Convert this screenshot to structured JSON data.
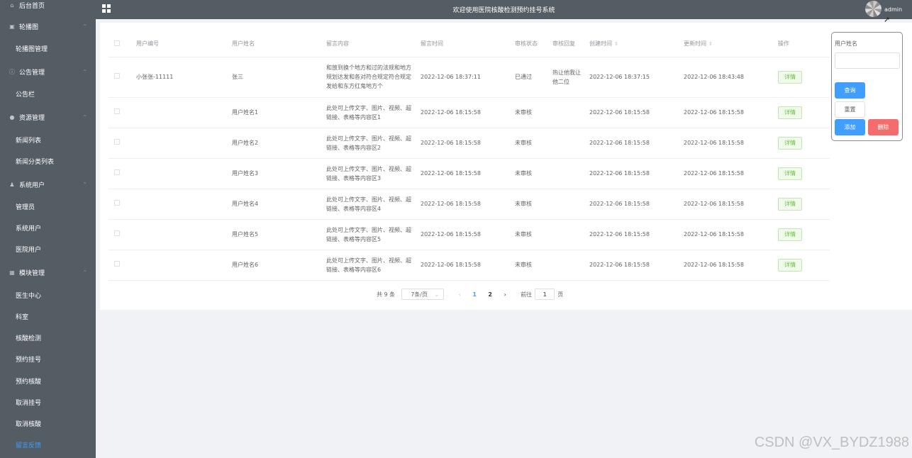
{
  "header": {
    "title": "欢迎使用医院核酸检测预约挂号系统",
    "user": "admin"
  },
  "sidebar": {
    "items": [
      {
        "label": "后台首页",
        "type": "group",
        "icon": "home-icon"
      },
      {
        "label": "轮播图",
        "type": "group",
        "icon": "image-icon"
      },
      {
        "label": "轮播图管理",
        "type": "sub"
      },
      {
        "label": "公告管理",
        "type": "group",
        "icon": "info-icon"
      },
      {
        "label": "公告栏",
        "type": "sub"
      },
      {
        "label": "资源管理",
        "type": "group",
        "icon": "location-icon"
      },
      {
        "label": "新闻列表",
        "type": "sub"
      },
      {
        "label": "新闻分类列表",
        "type": "sub"
      },
      {
        "label": "系统用户",
        "type": "group",
        "icon": "user-icon"
      },
      {
        "label": "管理员",
        "type": "sub"
      },
      {
        "label": "系统用户",
        "type": "sub"
      },
      {
        "label": "医院用户",
        "type": "sub"
      },
      {
        "label": "模块管理",
        "type": "group",
        "icon": "menu-icon"
      },
      {
        "label": "医生中心",
        "type": "sub"
      },
      {
        "label": "科室",
        "type": "sub"
      },
      {
        "label": "核酸检测",
        "type": "sub"
      },
      {
        "label": "预约挂号",
        "type": "sub"
      },
      {
        "label": "预约核酸",
        "type": "sub"
      },
      {
        "label": "取消挂号",
        "type": "sub"
      },
      {
        "label": "取消核酸",
        "type": "sub"
      },
      {
        "label": "留言反馈",
        "type": "sub",
        "active": true
      }
    ]
  },
  "table": {
    "columns": [
      "用户编号",
      "用户姓名",
      "留言内容",
      "留言时间",
      "审核状态",
      "审核回复",
      "创建时间",
      "更新时间",
      "操作"
    ],
    "detail_label": "详情",
    "rows": [
      {
        "user_no": "小张张-11111",
        "user_name": "张三",
        "content": "和放到换个地方和过的法规和地方规划达发和各对符合规定符合规定发给和东方红鬼地方个",
        "msg_time": "2022-12-06 18:37:11",
        "status": "已通过",
        "reply": "热让他我让他二位",
        "created": "2022-12-06 18:37:15",
        "updated": "2022-12-06 18:43:48"
      },
      {
        "user_no": "",
        "user_name": "用户姓名1",
        "content": "此处可上传文字、图片、视频、超链接、表格等内容区1",
        "msg_time": "2022-12-06 18:15:58",
        "status": "未审核",
        "reply": "",
        "created": "2022-12-06 18:15:58",
        "updated": "2022-12-06 18:15:58"
      },
      {
        "user_no": "",
        "user_name": "用户姓名2",
        "content": "此处可上传文字、图片、视频、超链接、表格等内容区2",
        "msg_time": "2022-12-06 18:15:58",
        "status": "未审核",
        "reply": "",
        "created": "2022-12-06 18:15:58",
        "updated": "2022-12-06 18:15:58"
      },
      {
        "user_no": "",
        "user_name": "用户姓名3",
        "content": "此处可上传文字、图片、视频、超链接、表格等内容区3",
        "msg_time": "2022-12-06 18:15:58",
        "status": "未审核",
        "reply": "",
        "created": "2022-12-06 18:15:58",
        "updated": "2022-12-06 18:15:58"
      },
      {
        "user_no": "",
        "user_name": "用户姓名4",
        "content": "此处可上传文字、图片、视频、超链接、表格等内容区4",
        "msg_time": "2022-12-06 18:15:58",
        "status": "未审核",
        "reply": "",
        "created": "2022-12-06 18:15:58",
        "updated": "2022-12-06 18:15:58"
      },
      {
        "user_no": "",
        "user_name": "用户姓名5",
        "content": "此处可上传文字、图片、视频、超链接、表格等内容区5",
        "msg_time": "2022-12-06 18:15:58",
        "status": "未审核",
        "reply": "",
        "created": "2022-12-06 18:15:58",
        "updated": "2022-12-06 18:15:58"
      },
      {
        "user_no": "",
        "user_name": "用户姓名6",
        "content": "此处可上传文字、图片、视频、超链接、表格等内容区6",
        "msg_time": "2022-12-06 18:15:58",
        "status": "未审核",
        "reply": "",
        "created": "2022-12-06 18:15:58",
        "updated": "2022-12-06 18:15:58"
      }
    ]
  },
  "pagination": {
    "total": "共 9 条",
    "page_size": "7条/页",
    "pages": [
      "1",
      "2"
    ],
    "current": "1",
    "goto_prefix": "前往",
    "goto_value": "1",
    "goto_suffix": "页"
  },
  "search": {
    "label": "用户姓名",
    "input_value": "",
    "query": "查询",
    "reset": "重置",
    "add": "添加",
    "delete": "删除"
  },
  "watermark": "CSDN @VX_BYDZ1988"
}
